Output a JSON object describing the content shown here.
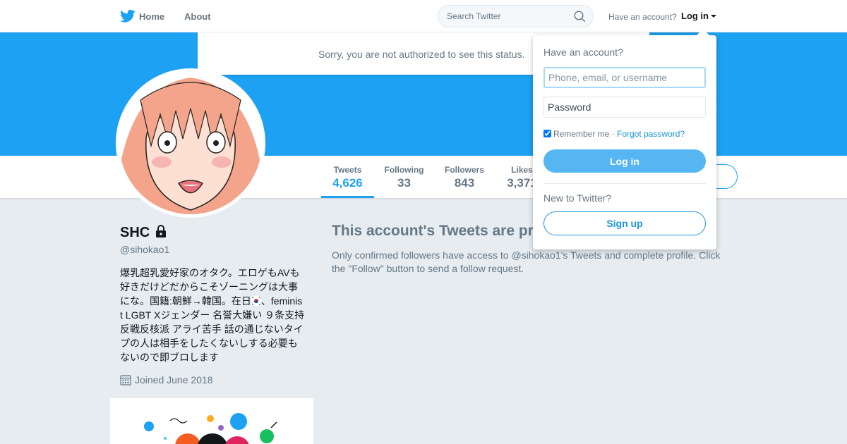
{
  "nav": {
    "home_label": "Home",
    "about_label": "About",
    "search_placeholder": "Search Twitter",
    "have_account": "Have an account?",
    "login_label": "Log in"
  },
  "notice": {
    "text": "Sorry, you are not authorized to see this status."
  },
  "stats": [
    {
      "label": "Tweets",
      "value": "4,626"
    },
    {
      "label": "Following",
      "value": "33"
    },
    {
      "label": "Followers",
      "value": "843"
    },
    {
      "label": "Likes",
      "value": "3,371"
    }
  ],
  "profile": {
    "name": "SHC",
    "handle": "@sihokao1",
    "bio_line1": "爆乳超乳愛好家のオタク。エロゲもAVも好きだけどだからこそゾーニングは大事にな。国籍:朝鮮→韓国。在日",
    "bio_line2": "、feminist LGBT Xジェンダー 名誉大嫌い ９条支持 反戦反核派 アライ苦手 話の通じないタイプの人は相手をしたくないしする必要もないので即ブロします",
    "joined": "Joined June 2018"
  },
  "protected": {
    "title": "This account's Tweets are protected.",
    "body": "Only confirmed followers have access to @sihokao1's Tweets and complete profile. Click the \"Follow\" button to send a follow request."
  },
  "login_dropdown": {
    "heading": "Have an account?",
    "username_placeholder": "Phone, email, or username",
    "password_placeholder": "Password",
    "remember_label": "Remember me",
    "separator": "·",
    "forgot_label": "Forgot password?",
    "login_button": "Log in",
    "new_label": "New to Twitter?",
    "signup_button": "Sign up"
  },
  "colors": {
    "brand": "#1da1f2",
    "link": "#1b95e0",
    "muted": "#657786"
  }
}
